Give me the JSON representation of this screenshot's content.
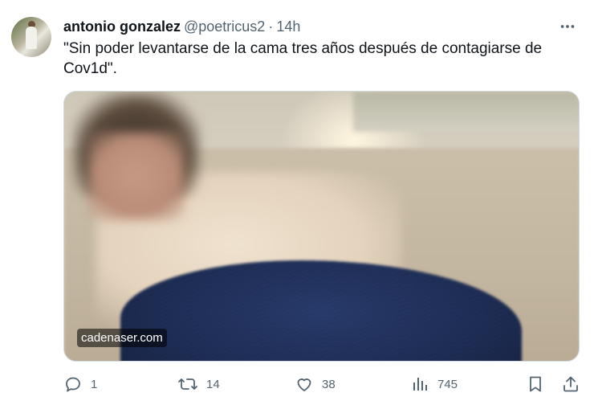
{
  "tweet": {
    "author_name": "antonio gonzalez",
    "handle": "@poetricus2",
    "separator": "·",
    "time": "14h",
    "text": "\"Sin poder levantarse de la cama tres años después de contagiarse de Cov1d\".",
    "media": {
      "source_label": "cadenaser.com"
    },
    "stats": {
      "replies": "1",
      "reposts": "14",
      "likes": "38",
      "views": "745"
    }
  },
  "icons": {
    "more": "more-horizontal-icon",
    "reply": "reply-icon",
    "repost": "repost-icon",
    "like": "heart-icon",
    "views": "analytics-icon",
    "bookmark": "bookmark-icon",
    "share": "share-icon"
  },
  "colors": {
    "text_primary": "#0f1419",
    "text_secondary": "#536471",
    "border": "#cfd9de"
  }
}
